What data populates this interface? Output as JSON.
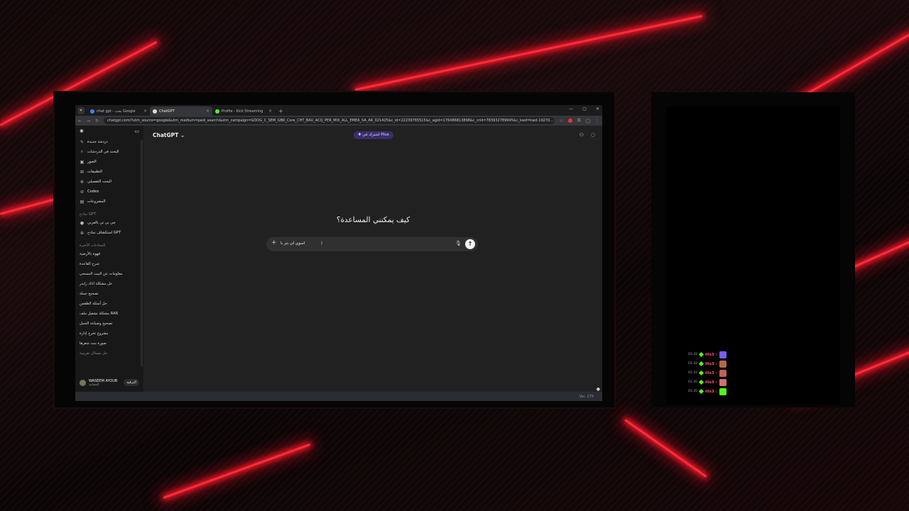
{
  "browser": {
    "tabs": [
      {
        "title": "chat gpt - بحث Google",
        "favicon_color": "#4285f4",
        "active": false
      },
      {
        "title": "ChatGPT",
        "favicon_color": "#dddddd",
        "active": true
      },
      {
        "title": "Profile - Kick Streaming",
        "favicon_color": "#53fc18",
        "active": false
      }
    ],
    "url": "chatgpt.com/?utm_source=google&utm_medium=paid_search&utm_campaign=GOOG_C_SEM_GBR_Core_CHT_BAU_ACQ_PER_MIX_ALL_EMEA_SA_AR_021425&c_id=22239765515&c_agid=176486813898&c_crid=783932789945&c_kwd=kwd-19270...",
    "new_tab": "+",
    "tab_close": "×"
  },
  "sidebar": {
    "items": [
      {
        "label": "دردشة جديدة",
        "icon": "edit-icon"
      },
      {
        "label": "البحث في الدردشات",
        "icon": "search-icon"
      },
      {
        "label": "الصور",
        "icon": "image-icon"
      },
      {
        "label": "التطبيقات",
        "icon": "apps-icon"
      },
      {
        "label": "البحث التفصيلي",
        "icon": "telescope-icon"
      },
      {
        "label": "Codex",
        "icon": "codex-icon"
      },
      {
        "label": "المشروعات",
        "icon": "folder-icon"
      }
    ],
    "gpts_heading": "نماذج GPT",
    "gpts": [
      {
        "label": "جي بي تي بالعربي",
        "icon": "gpt-icon"
      },
      {
        "label": "استكشاف نماذج GPT",
        "icon": "explore-icon"
      }
    ],
    "recent_heading": "المحادثات الأخيرة",
    "chats": [
      "قهوة بالأرضية",
      "شرح القاعدة",
      "معلومات عن البيت المسحي",
      "حل مشكلة اتاك رايدر",
      "تصحيح جملة",
      "حل أسئلة الطقس",
      "مشكلة تشغيل ملف RAR",
      "تصحيح وصياغة الجمل",
      "مشروع تخرج إدارة",
      "صورة بنت شعرها",
      "حل مسائل تقريبية"
    ],
    "user": {
      "name": "WASEEM AYOUB",
      "plan": "المجانية",
      "upgrade": "الترقية"
    }
  },
  "main": {
    "model": "ChatGPT",
    "plus_button": "اشترك في Plus",
    "greeting": "كيف يمكنني المساعدة؟",
    "composer_text": "اسوي لي بتر با"
  },
  "statusbar": {
    "version": "Ver. 279"
  },
  "stream_chat": [
    {
      "time": "01:32",
      "nick": "ilis3 :",
      "emote_color": "#7a5cff"
    },
    {
      "time": "01:32",
      "nick": "ilis3 :",
      "emote_color": "#b06a4a"
    },
    {
      "time": "01:33",
      "nick": "ilis3 :",
      "emote_color": "#c26060"
    },
    {
      "time": "01:35",
      "nick": "ilis3 :",
      "emote_color": "#d07070"
    },
    {
      "time": "01:35",
      "nick": "ilis3 :",
      "emote_color": "#53fc18"
    }
  ],
  "colors": {
    "accent_red": "#ff2b3a",
    "kick_green": "#53fc18",
    "plus_purple": "#3a2d6a"
  }
}
